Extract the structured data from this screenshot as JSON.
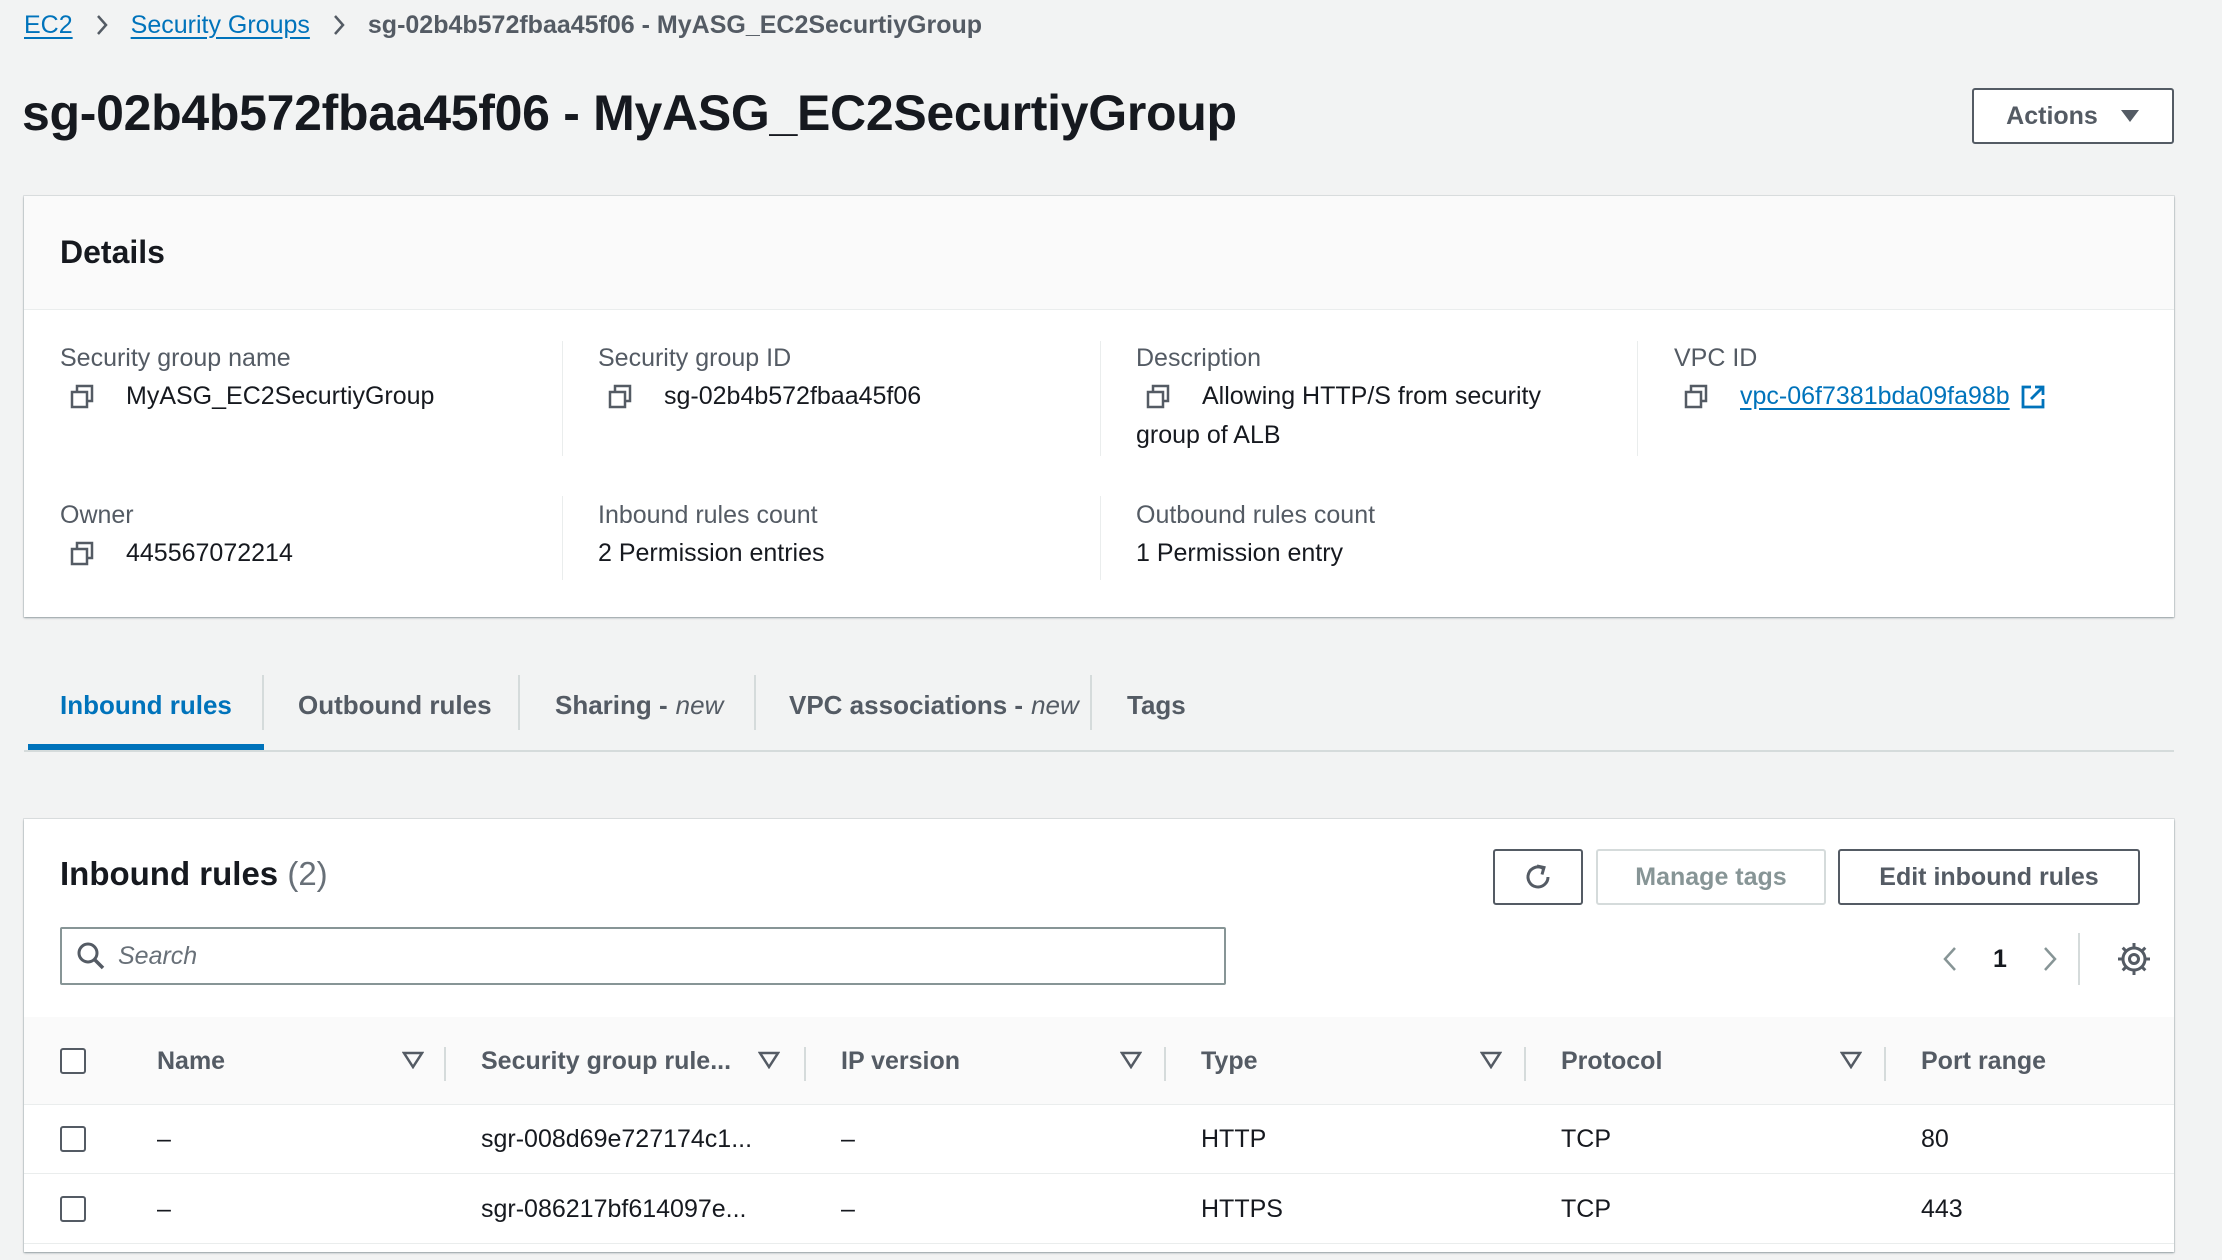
{
  "breadcrumb": {
    "root": "EC2",
    "parent": "Security Groups",
    "current": "sg-02b4b572fbaa45f06 - MyASG_EC2SecurtiyGroup"
  },
  "header": {
    "title": "sg-02b4b572fbaa45f06 - MyASG_EC2SecurtiyGroup",
    "actions_label": "Actions"
  },
  "details": {
    "title": "Details",
    "sg_name_label": "Security group name",
    "sg_name": "MyASG_EC2SecurtiyGroup",
    "sg_id_label": "Security group ID",
    "sg_id": "sg-02b4b572fbaa45f06",
    "description_label": "Description",
    "description_line1": "Allowing HTTP/S from security",
    "description_line2": "group of ALB",
    "vpc_label": "VPC ID",
    "vpc_id": "vpc-06f7381bda09fa98b",
    "owner_label": "Owner",
    "owner": "445567072214",
    "inbound_count_label": "Inbound rules count",
    "inbound_count": "2 Permission entries",
    "outbound_count_label": "Outbound rules count",
    "outbound_count": "1 Permission entry"
  },
  "tabs": {
    "inbound": "Inbound rules",
    "outbound": "Outbound rules",
    "sharing": "Sharing - ",
    "sharing_new": "new",
    "vpc_assoc": "VPC associations - ",
    "vpc_assoc_new": "new",
    "tags": "Tags",
    "active": "Inbound rules"
  },
  "rules": {
    "title": "Inbound rules",
    "count": "(2)",
    "manage_tags_label": "Manage tags",
    "edit_label": "Edit inbound rules",
    "search_placeholder": "Search",
    "page": "1",
    "columns": {
      "name": "Name",
      "rule_id": "Security group rule...",
      "ip_version": "IP version",
      "type": "Type",
      "protocol": "Protocol",
      "port_range": "Port range"
    },
    "rows": [
      {
        "name": "–",
        "rule_id": "sgr-008d69e727174c1...",
        "ip_version": "–",
        "type": "HTTP",
        "protocol": "TCP",
        "port_range": "80"
      },
      {
        "name": "–",
        "rule_id": "sgr-086217bf614097e...",
        "ip_version": "–",
        "type": "HTTPS",
        "protocol": "TCP",
        "port_range": "443"
      }
    ]
  },
  "colors": {
    "link": "#0073bb",
    "text": "#16191f",
    "secondary_text": "#545b64",
    "background": "#f2f3f3"
  }
}
